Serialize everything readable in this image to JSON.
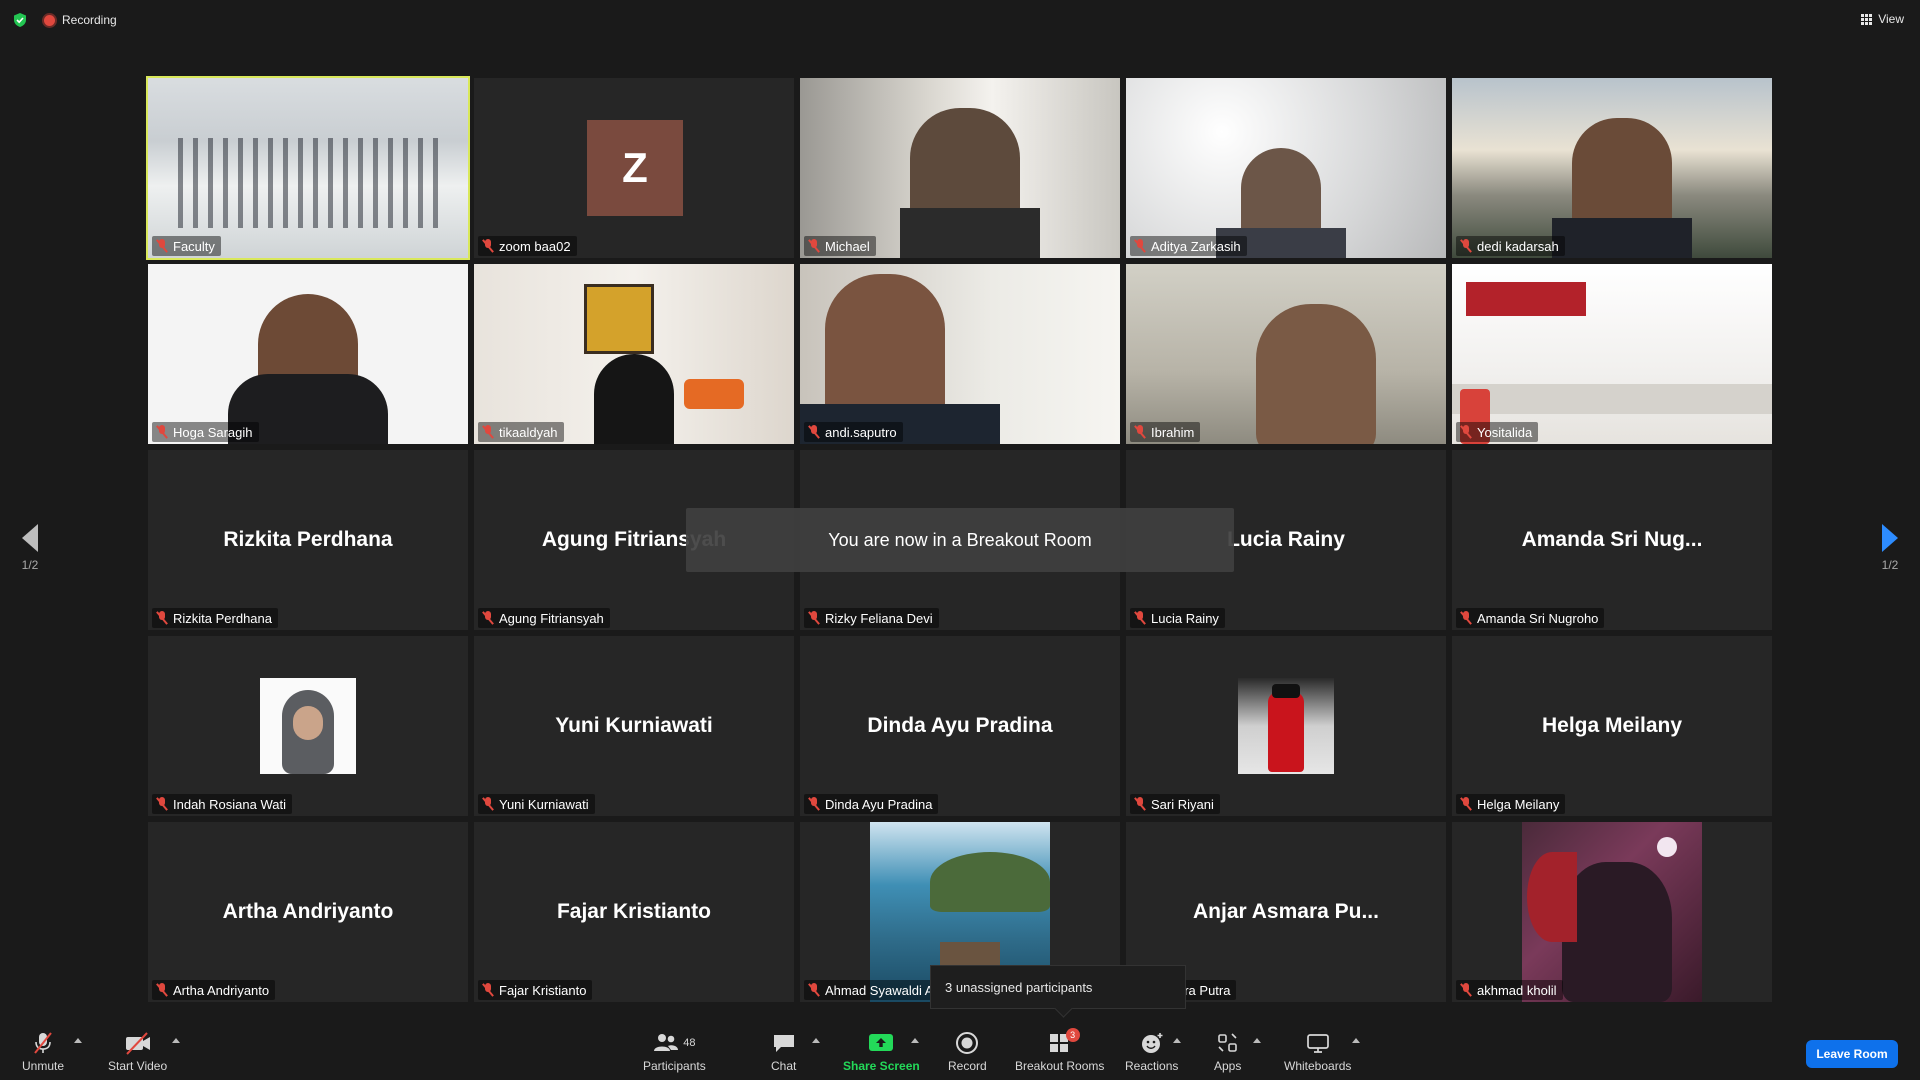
{
  "topbar": {
    "recording_label": "Recording",
    "view_label": "View"
  },
  "tiles": [
    {
      "name": "Faculty",
      "kind": "video",
      "scene": "classroom"
    },
    {
      "name": "zoom baa02",
      "kind": "avatar",
      "avatar_letter": "Z"
    },
    {
      "name": "Michael",
      "kind": "video",
      "scene": "office"
    },
    {
      "name": "Aditya Zarkasih",
      "kind": "video",
      "scene": "bright"
    },
    {
      "name": "dedi kadarsah",
      "kind": "video",
      "scene": "landscape"
    },
    {
      "name": "Hoga Saragih",
      "kind": "video",
      "scene": "white"
    },
    {
      "name": "tikaaldyah",
      "kind": "video",
      "scene": "room"
    },
    {
      "name": "andi.saputro",
      "kind": "video",
      "scene": "office2"
    },
    {
      "name": "Ibrahim",
      "kind": "video",
      "scene": "office3"
    },
    {
      "name": "Yositalida",
      "kind": "video",
      "scene": "slide"
    },
    {
      "name": "Rizkita Perdhana",
      "kind": "text",
      "display": "Rizkita Perdhana"
    },
    {
      "name": "Agung Fitriansyah",
      "kind": "text",
      "display": "Agung Fitriansyah"
    },
    {
      "name": "Rizky Feliana Devi",
      "kind": "text",
      "display": ""
    },
    {
      "name": "Lucia Rainy",
      "kind": "text",
      "display": "Lucia Rainy"
    },
    {
      "name": "Amanda Sri Nugroho",
      "kind": "text",
      "display": "Amanda Sri Nug..."
    },
    {
      "name": "Indah Rosiana Wati",
      "kind": "photo",
      "scene": "hijab"
    },
    {
      "name": "Yuni Kurniawati",
      "kind": "text",
      "display": "Yuni Kurniawati"
    },
    {
      "name": "Dinda Ayu Pradina",
      "kind": "text",
      "display": "Dinda Ayu Pradina"
    },
    {
      "name": "Sari Riyani",
      "kind": "photo",
      "scene": "bottle"
    },
    {
      "name": "Helga Meilany",
      "kind": "text",
      "display": "Helga Meilany"
    },
    {
      "name": "Artha Andriyanto",
      "kind": "text",
      "display": "Artha Andriyanto"
    },
    {
      "name": "Fajar Kristianto",
      "kind": "text",
      "display": "Fajar Kristianto"
    },
    {
      "name": "Ahmad Syawaldi A",
      "kind": "photo-tall",
      "scene": "cliff"
    },
    {
      "name": "Asmara Putra",
      "kind": "text",
      "display": "Anjar Asmara Pu..."
    },
    {
      "name": "akhmad kholil",
      "kind": "photo-tall",
      "scene": "warrior"
    }
  ],
  "nav": {
    "left_page": "1/2",
    "right_page": "1/2"
  },
  "toast": {
    "text": "You are now in a Breakout Room"
  },
  "tooltip": {
    "text": "3 unassigned participants"
  },
  "toolbar": {
    "unmute": "Unmute",
    "start_video": "Start Video",
    "participants": "Participants",
    "participants_count": "48",
    "chat": "Chat",
    "share_screen": "Share Screen",
    "record": "Record",
    "breakout_rooms": "Breakout Rooms",
    "breakout_badge": "3",
    "reactions": "Reactions",
    "apps": "Apps",
    "whiteboards": "Whiteboards",
    "leave_room": "Leave Room"
  },
  "colors": {
    "accent": "#2d8cff",
    "active_speaker": "#d9e85a",
    "share_green": "#23d959",
    "muted_red": "#e0483e",
    "leave_blue": "#0e71eb"
  }
}
